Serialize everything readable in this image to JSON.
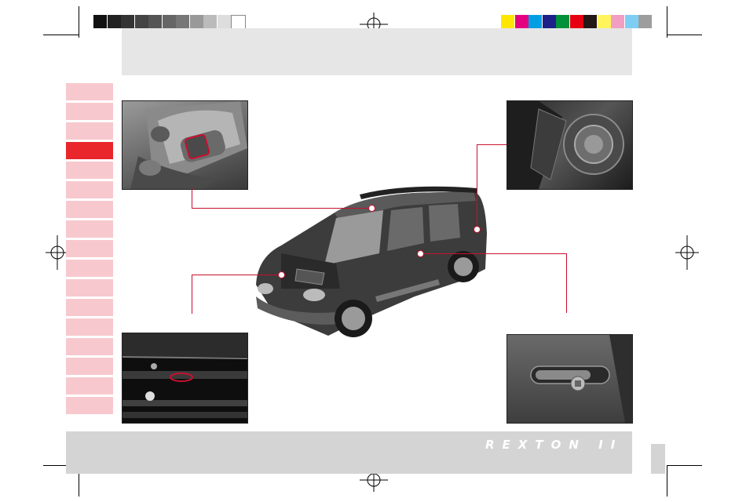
{
  "header": {
    "bar_color": "#e6e6e6"
  },
  "color_bar": {
    "grays": [
      "#111111",
      "#222222",
      "#333333",
      "#444444",
      "#555555",
      "#666666",
      "#777777",
      "#999999",
      "#bbbbbb",
      "#dddddd",
      "#ffffff"
    ],
    "colors": [
      "#ffe600",
      "#e4007f",
      "#009fe3",
      "#1d2088",
      "#00913a",
      "#e60012",
      "#231815",
      "#fff45c",
      "#f19ec2",
      "#7ecef4",
      "#9d9d9d"
    ]
  },
  "side_tabs": {
    "count": 17,
    "active_index": 3,
    "active_color": "#e8262c",
    "inactive_color": "#f7c9cf"
  },
  "photos": [
    {
      "name": "overhead-console-photo",
      "icon": "sunroof-switch-icon"
    },
    {
      "name": "fuel-filler-photo",
      "icon": "fuel-cap-icon"
    },
    {
      "name": "hood-latch-photo",
      "icon": "hood-release-icon"
    },
    {
      "name": "door-handle-photo",
      "icon": "door-handle-icon"
    },
    {
      "name": "vehicle-photo",
      "icon": "suv-icon"
    }
  ],
  "footer": {
    "logo_text": "REXTON II",
    "bar_color": "#d4d4d4",
    "accent_color": "#c8102e"
  }
}
